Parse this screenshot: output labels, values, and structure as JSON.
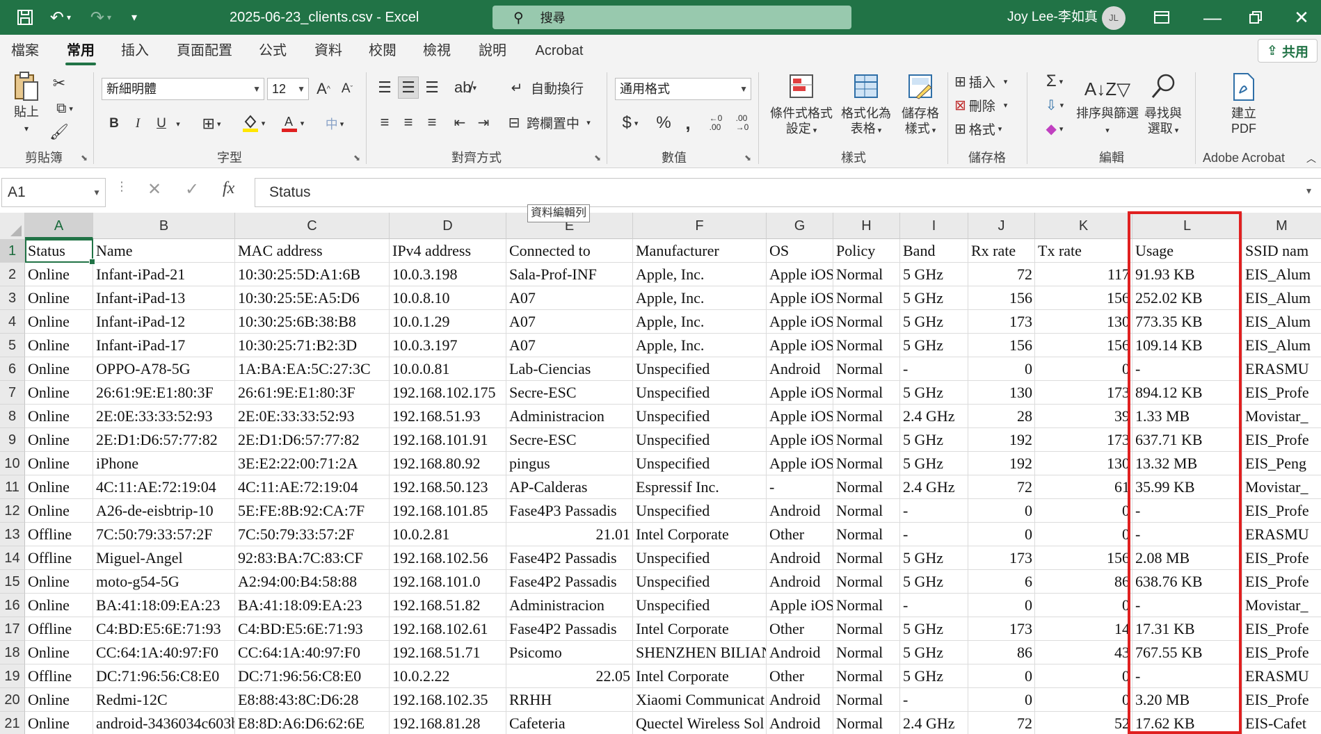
{
  "titlebar": {
    "doc_title": "2025-06-23_clients.csv  -  Excel",
    "search_label": "搜尋",
    "user_name": "Joy Lee-李如真",
    "avatar_initials": "JL"
  },
  "menu": {
    "tabs": [
      "檔案",
      "常用",
      "插入",
      "頁面配置",
      "公式",
      "資料",
      "校閱",
      "檢視",
      "說明",
      "Acrobat"
    ],
    "active_tab": "常用",
    "share_label": "共用"
  },
  "ribbon": {
    "clipboard": {
      "paste_label": "貼上",
      "group_label": "剪貼簿"
    },
    "font": {
      "font_name": "新細明體",
      "font_size": "12",
      "bold": "B",
      "italic": "I",
      "underline": "U",
      "group_label": "字型"
    },
    "alignment": {
      "wrap_label": "自動換行",
      "merge_label": "跨欄置中",
      "group_label": "對齊方式"
    },
    "number": {
      "format_label": "通用格式",
      "group_label": "數值"
    },
    "styles": {
      "cond_format_label_1": "條件式格式",
      "cond_format_label_2": "設定",
      "format_table_label_1": "格式化為",
      "format_table_label_2": "表格",
      "cell_styles_label_1": "儲存格",
      "cell_styles_label_2": "樣式",
      "group_label": "樣式"
    },
    "cells": {
      "insert_label": "插入",
      "delete_label": "刪除",
      "format_label": "格式",
      "group_label": "儲存格"
    },
    "editing": {
      "sort_label_1": "排序與篩選",
      "find_label_1": "尋找與",
      "find_label_2": "選取",
      "group_label": "編輯"
    },
    "acrobat": {
      "create_pdf_label_1": "建立",
      "create_pdf_label_2": "PDF",
      "group_label": "Adobe Acrobat"
    }
  },
  "formula_bar": {
    "name_box": "A1",
    "fx": "fx",
    "content": "Status",
    "tooltip": "資料編輯列"
  },
  "sheet": {
    "columns": [
      "A",
      "B",
      "C",
      "D",
      "E",
      "F",
      "G",
      "H",
      "I",
      "J",
      "K",
      "L",
      "M"
    ],
    "row_numbers": [
      "1",
      "2",
      "3",
      "4",
      "5",
      "6",
      "7",
      "8",
      "9",
      "10",
      "11",
      "12",
      "13",
      "14",
      "15",
      "16",
      "17",
      "18",
      "19",
      "20",
      "21"
    ],
    "rows": [
      [
        "Status",
        "Name",
        "MAC address",
        "IPv4 address",
        "Connected to",
        "Manufacturer",
        "OS",
        "Policy",
        "Band",
        "Rx rate",
        "Tx rate",
        "Usage",
        "SSID nam"
      ],
      [
        "Online",
        "Infant-iPad-21",
        "10:30:25:5D:A1:6B",
        "10.0.3.198",
        "Sala-Prof-INF",
        "Apple, Inc.",
        "Apple iOS",
        "Normal",
        "5 GHz",
        "72",
        "117",
        "91.93 KB",
        "EIS_Alum"
      ],
      [
        "Online",
        "Infant-iPad-13",
        "10:30:25:5E:A5:D6",
        "10.0.8.10",
        "A07",
        "Apple, Inc.",
        "Apple iOS",
        "Normal",
        "5 GHz",
        "156",
        "156",
        "252.02 KB",
        "EIS_Alum"
      ],
      [
        "Online",
        "Infant-iPad-12",
        "10:30:25:6B:38:B8",
        "10.0.1.29",
        "A07",
        "Apple, Inc.",
        "Apple iOS",
        "Normal",
        "5 GHz",
        "173",
        "130",
        "773.35 KB",
        "EIS_Alum"
      ],
      [
        "Online",
        "Infant-iPad-17",
        "10:30:25:71:B2:3D",
        "10.0.3.197",
        "A07",
        "Apple, Inc.",
        "Apple iOS",
        "Normal",
        "5 GHz",
        "156",
        "156",
        "109.14 KB",
        "EIS_Alum"
      ],
      [
        "Online",
        "OPPO-A78-5G",
        "1A:BA:EA:5C:27:3C",
        "10.0.0.81",
        "Lab-Ciencias",
        "Unspecified",
        "Android",
        "Normal",
        "-",
        "0",
        "0",
        "-",
        "ERASMU"
      ],
      [
        "Online",
        "26:61:9E:E1:80:3F",
        "26:61:9E:E1:80:3F",
        "192.168.102.175",
        "Secre-ESC",
        "Unspecified",
        "Apple iOS",
        "Normal",
        "5 GHz",
        "130",
        "173",
        "894.12 KB",
        "EIS_Profe"
      ],
      [
        "Online",
        "2E:0E:33:33:52:93",
        "2E:0E:33:33:52:93",
        "192.168.51.93",
        "Administracion",
        "Unspecified",
        "Apple iOS",
        "Normal",
        "2.4 GHz",
        "28",
        "39",
        "1.33 MB",
        "Movistar_"
      ],
      [
        "Online",
        "2E:D1:D6:57:77:82",
        "2E:D1:D6:57:77:82",
        "192.168.101.91",
        "Secre-ESC",
        "Unspecified",
        "Apple iOS",
        "Normal",
        "5 GHz",
        "192",
        "173",
        "637.71 KB",
        "EIS_Profe"
      ],
      [
        "Online",
        "iPhone",
        "3E:E2:22:00:71:2A",
        "192.168.80.92",
        "pingus",
        "Unspecified",
        "Apple iOS",
        "Normal",
        "5 GHz",
        "192",
        "130",
        "13.32 MB",
        "EIS_Peng"
      ],
      [
        "Online",
        "4C:11:AE:72:19:04",
        "4C:11:AE:72:19:04",
        "192.168.50.123",
        "AP-Calderas",
        "Espressif Inc.",
        "-",
        "Normal",
        "2.4 GHz",
        "72",
        "61",
        "35.99 KB",
        "Movistar_"
      ],
      [
        "Online",
        "A26-de-eisbtrip-10",
        "5E:FE:8B:92:CA:7F",
        "192.168.101.85",
        "Fase4P3 Passadis",
        "Unspecified",
        "Android",
        "Normal",
        "-",
        "0",
        "0",
        "-",
        "EIS_Profe"
      ],
      [
        "Offline",
        "7C:50:79:33:57:2F",
        "7C:50:79:33:57:2F",
        "10.0.2.81",
        "21.01",
        "Intel Corporate",
        "Other",
        "Normal",
        "-",
        "0",
        "0",
        "-",
        "ERASMU"
      ],
      [
        "Offline",
        "Miguel-Angel",
        "92:83:BA:7C:83:CF",
        "192.168.102.56",
        "Fase4P2 Passadis",
        "Unspecified",
        "Android",
        "Normal",
        "5 GHz",
        "173",
        "156",
        "2.08 MB",
        "EIS_Profe"
      ],
      [
        "Online",
        "moto-g54-5G",
        "A2:94:00:B4:58:88",
        "192.168.101.0",
        "Fase4P2 Passadis",
        "Unspecified",
        "Android",
        "Normal",
        "5 GHz",
        "6",
        "86",
        "638.76 KB",
        "EIS_Profe"
      ],
      [
        "Online",
        "BA:41:18:09:EA:23",
        "BA:41:18:09:EA:23",
        "192.168.51.82",
        "Administracion",
        "Unspecified",
        "Apple iOS",
        "Normal",
        "-",
        "0",
        "0",
        "-",
        "Movistar_"
      ],
      [
        "Offline",
        "C4:BD:E5:6E:71:93",
        "C4:BD:E5:6E:71:93",
        "192.168.102.61",
        "Fase4P2 Passadis",
        "Intel Corporate",
        "Other",
        "Normal",
        "5 GHz",
        "173",
        "14",
        "17.31 KB",
        "EIS_Profe"
      ],
      [
        "Online",
        "CC:64:1A:40:97:F0",
        "CC:64:1A:40:97:F0",
        "192.168.51.71",
        "Psicomo",
        "SHENZHEN BILIAN",
        "Android",
        "Normal",
        "5 GHz",
        "86",
        "43",
        "767.55 KB",
        "EIS_Profe"
      ],
      [
        "Offline",
        "DC:71:96:56:C8:E0",
        "DC:71:96:56:C8:E0",
        "10.0.2.22",
        "22.05",
        "Intel Corporate",
        "Other",
        "Normal",
        "5 GHz",
        "0",
        "0",
        "-",
        "ERASMU"
      ],
      [
        "Online",
        "Redmi-12C",
        "E8:88:43:8C:D6:28",
        "192.168.102.35",
        "RRHH",
        "Xiaomi Communicat",
        "Android",
        "Normal",
        "-",
        "0",
        "0",
        "3.20 MB",
        "EIS_Profe"
      ],
      [
        "Online",
        "android-3436034c603b",
        "E8:8D:A6:D6:62:6E",
        "192.168.81.28",
        "Cafeteria",
        "Quectel Wireless Sol",
        "Android",
        "Normal",
        "2.4 GHz",
        "72",
        "52",
        "17.62 KB",
        "EIS-Cafet"
      ]
    ]
  },
  "colors": {
    "accent": "#217346",
    "highlight": "#e02020"
  }
}
